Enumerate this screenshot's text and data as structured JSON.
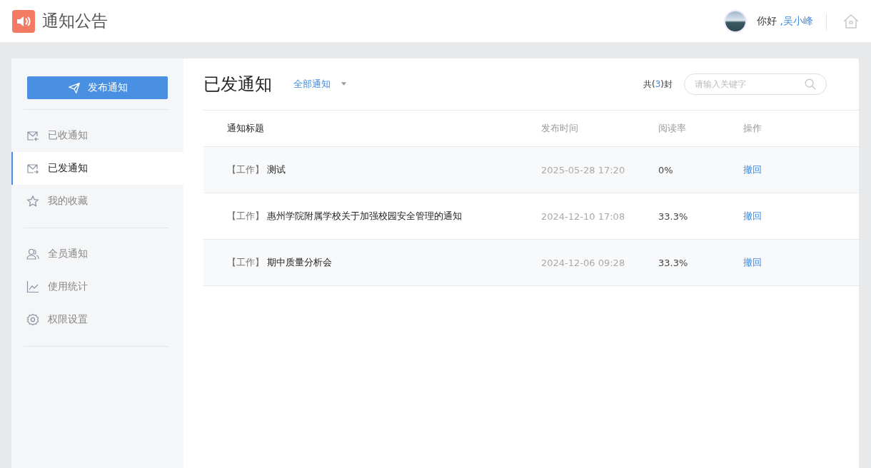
{
  "app": {
    "title": "通知公告"
  },
  "user": {
    "greeting": "你好 ",
    "name": ",吴小峰"
  },
  "sidebar": {
    "publish_button": "发布通知",
    "groups": [
      [
        {
          "label": "已收通知",
          "kind": "inbox",
          "selected": false
        },
        {
          "label": "已发通知",
          "kind": "sent",
          "selected": true
        },
        {
          "label": "我的收藏",
          "kind": "star",
          "selected": false
        }
      ],
      [
        {
          "label": "全员通知",
          "kind": "users",
          "selected": false
        },
        {
          "label": "使用统计",
          "kind": "chart",
          "selected": false
        },
        {
          "label": "权限设置",
          "kind": "gear",
          "selected": false
        }
      ]
    ]
  },
  "main": {
    "title": "已发通知",
    "filter": "全部通知",
    "count": {
      "prefix": "共(",
      "value": "3",
      "suffix": ")封"
    },
    "search": {
      "placeholder": "请输入关键字"
    }
  },
  "table": {
    "columns": [
      "通知标题",
      "发布时间",
      "阅读率",
      "操作"
    ],
    "rows": [
      {
        "tag": "【工作】",
        "title": "测试",
        "time": "2025-05-28 17:20",
        "rate": "0%",
        "action": "撤回"
      },
      {
        "tag": "【工作】",
        "title": "惠州学院附属学校关于加强校园安全管理的通知",
        "time": "2024-12-10 17:08",
        "rate": "33.3%",
        "action": "撤回"
      },
      {
        "tag": "【工作】",
        "title": "期中质量分析会",
        "time": "2024-12-06 09:28",
        "rate": "33.3%",
        "action": "撤回"
      }
    ]
  }
}
